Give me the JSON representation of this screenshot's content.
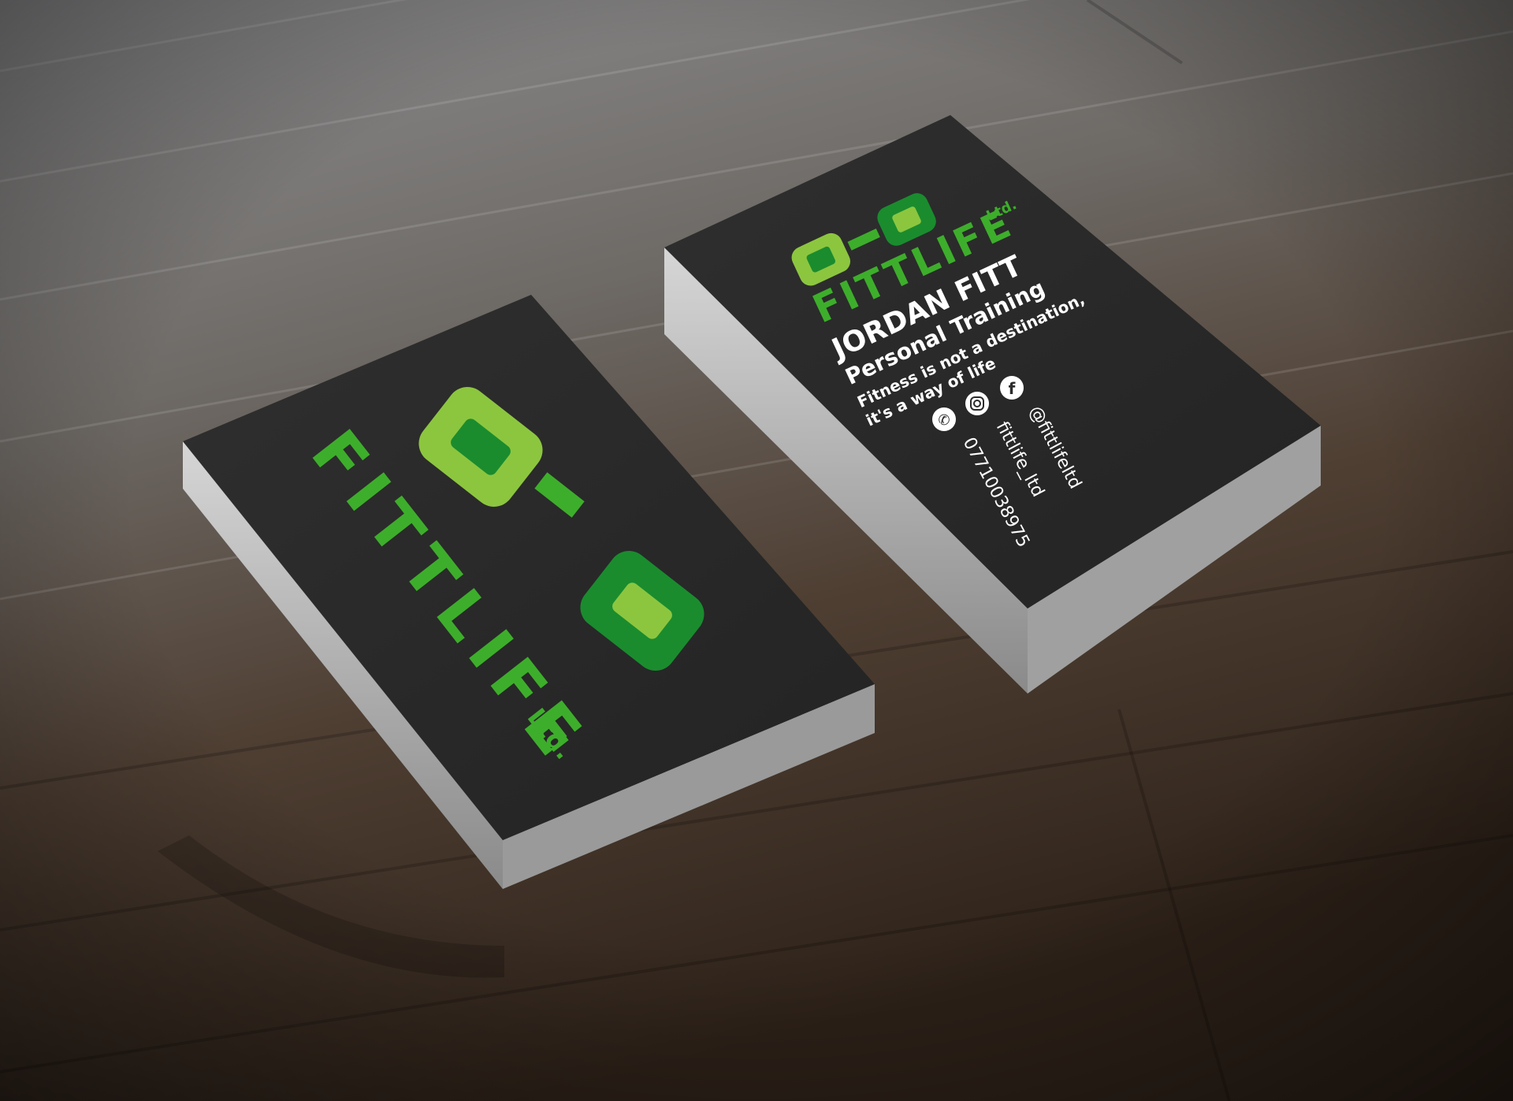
{
  "brand": {
    "name": "FITTLIFE",
    "suffix": "Ltd.",
    "colors": {
      "light_green": "#8cc63f",
      "green": "#3dae2b",
      "dark_green": "#1a8c2e",
      "card": "#2b2b2b"
    }
  },
  "front_card": {
    "logo_icon": "dumbbell-icon",
    "name": "FITTLIFE",
    "suffix": "Ltd."
  },
  "back_card": {
    "logo_icon": "dumbbell-icon",
    "brand_name": "FITTLIFE",
    "brand_suffix": "Ltd.",
    "person_name": "JORDAN FITT",
    "role": "Personal Training",
    "tagline_line1": "Fitness is not a destination,",
    "tagline_line2": "it's a way of life",
    "contacts": [
      {
        "icon": "phone-icon",
        "value": "07710038975"
      },
      {
        "icon": "instagram-icon",
        "value": "fittlife_ltd"
      },
      {
        "icon": "facebook-icon",
        "value": "@fittlifeltd"
      }
    ]
  }
}
